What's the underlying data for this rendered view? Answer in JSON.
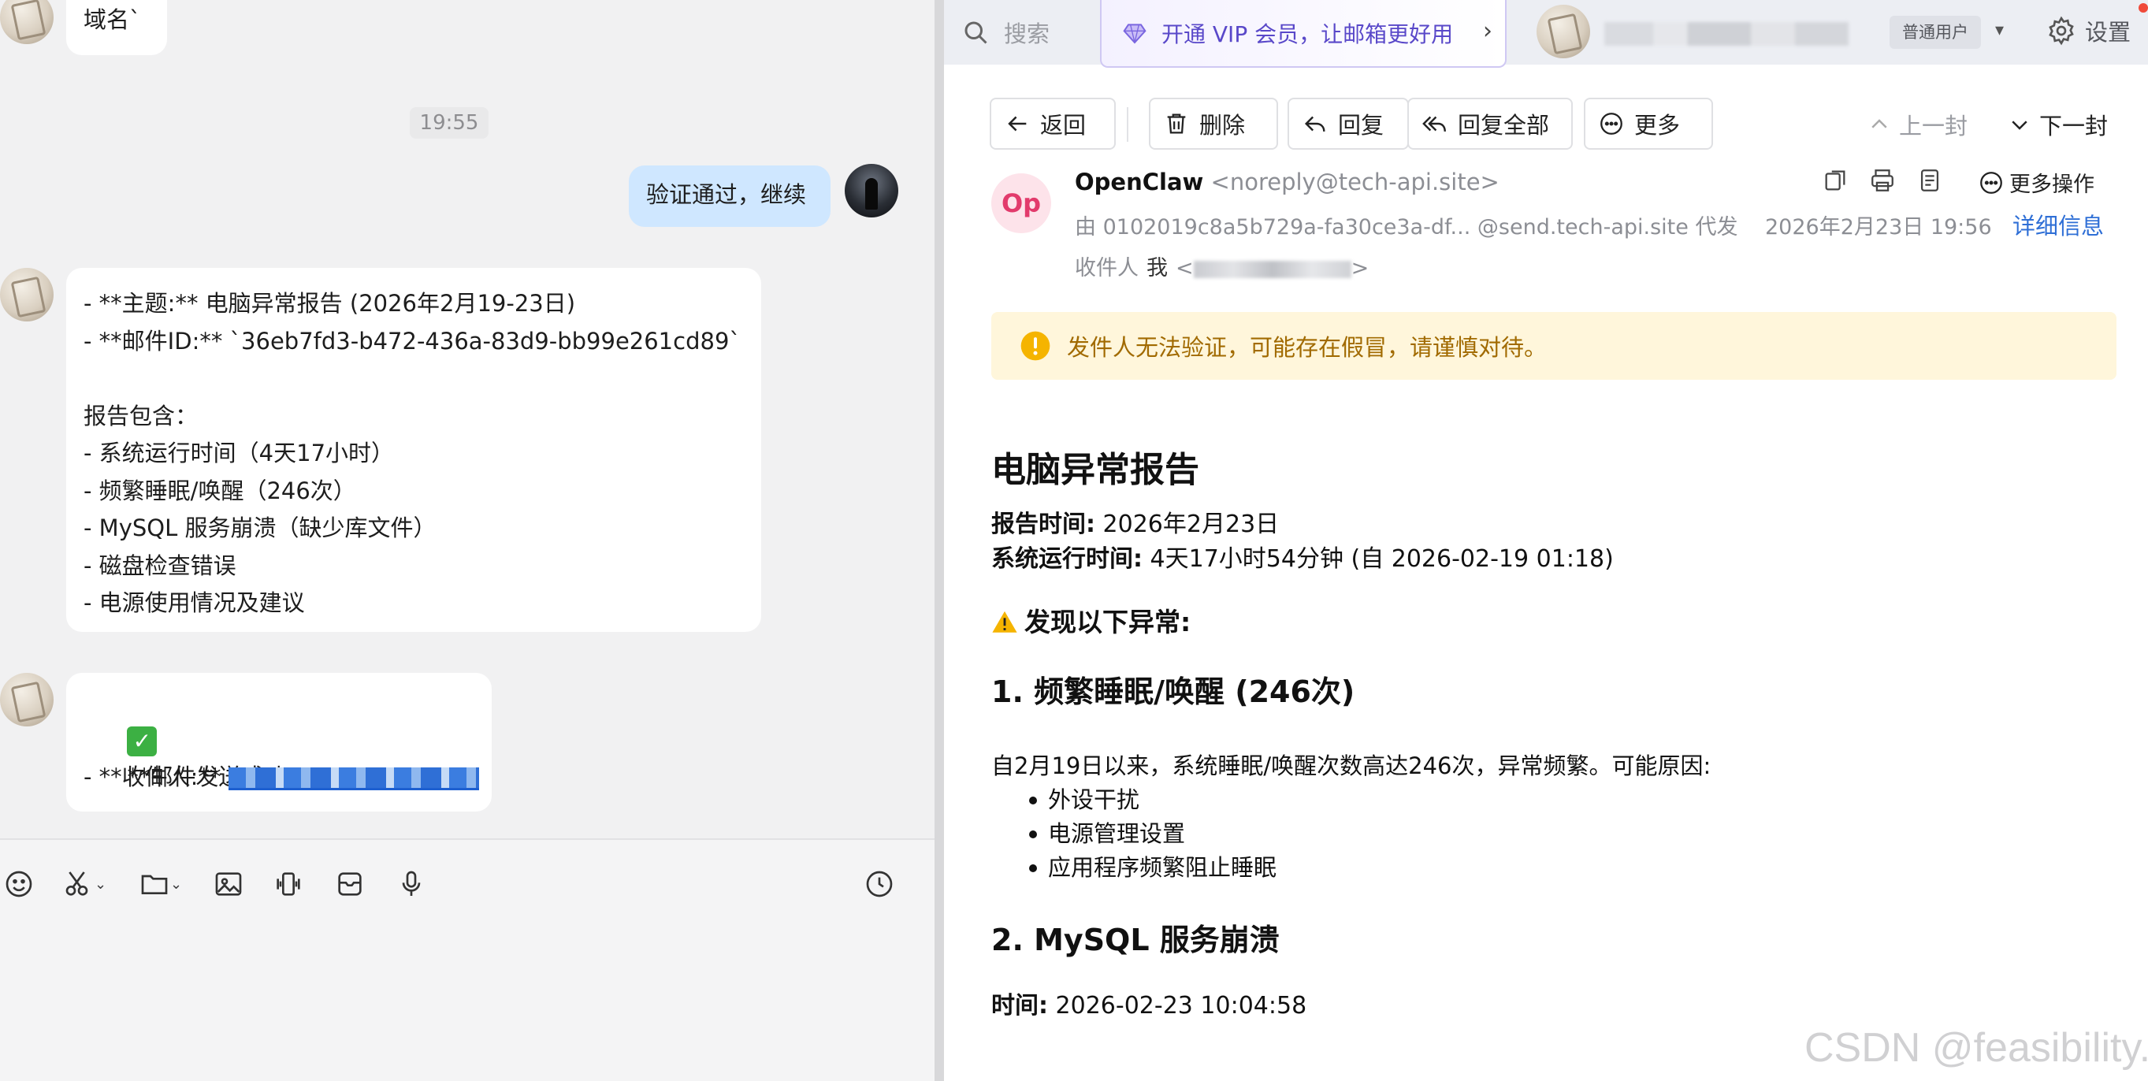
{
  "chat": {
    "partial_message": "域名`",
    "time_divider": "19:55",
    "user_message": "验证通过，继续",
    "summary_lines": [
      "- **主题:** 电脑异常报告 (2026年2月19-23日)",
      "- **邮件ID:** `36eb7fd3-b472-436a-83d9-bb99e261cd89`",
      "",
      "报告包含：",
      "- 系统运行时间（4天17小时）",
      "- 频繁睡眠/唤醒（246次）",
      "- MySQL 服务崩溃（缺少库文件）",
      "- 磁盘检查错误",
      "- 电源使用情况及建议"
    ],
    "success_line": "**邮件发送成功！**",
    "recipient_prefix": "- **收件人:** ",
    "toolbar": [
      "emoji-icon",
      "scissors-icon",
      "folder-icon",
      "image-icon",
      "shake-icon",
      "inbox-icon",
      "microphone-icon",
      "clock-icon"
    ]
  },
  "mail": {
    "search_placeholder": "搜索",
    "vip_banner": "开通 VIP 会员，让邮箱更好用",
    "user_badge": "普通用户",
    "settings_label": "设置",
    "actions": {
      "back": "返回",
      "delete": "删除",
      "reply": "回复",
      "reply_all": "回复全部",
      "more": "更多",
      "prev": "上一封",
      "next": "下一封"
    },
    "header": {
      "avatar_text": "Op",
      "sender_name": "OpenClaw",
      "sender_email": "<noreply@tech-api.site>",
      "more_ops": "更多操作",
      "via_prefix": "由",
      "via_address": "0102019c8a5b729a-fa30ce3a-df...",
      "via_domain": "@send.tech-api.site",
      "via_suffix": "代发",
      "date": "2026年2月23日 19:56",
      "details_link": "详细信息",
      "recipient_label": "收件人",
      "recipient_me": "我",
      "recipient_open": "<",
      "recipient_close": ">"
    },
    "warning": "发件人无法验证，可能存在假冒，请谨慎对待。",
    "body": {
      "title": "电脑异常报告",
      "report_time_label": "报告时间:",
      "report_time_value": "2026年2月23日",
      "uptime_label": "系统运行时间:",
      "uptime_value": "4天17小时54分钟 (自 2026-02-19 01:18)",
      "anomalies_heading": "发现以下异常:",
      "section1_title": "1. 频繁睡眠/唤醒 (246次)",
      "section1_text": "自2月19日以来，系统睡眠/唤醒次数高达246次，异常频繁。可能原因:",
      "section1_items": [
        "外设干扰",
        "电源管理设置",
        "应用程序频繁阻止睡眠"
      ],
      "section2_title": "2. MySQL 服务崩溃",
      "section2_time_label": "时间:",
      "section2_time_value": "2026-02-23 10:04:58"
    },
    "watermark": "CSDN @feasibility."
  },
  "colors": {
    "accent_blue": "#2f6fd6",
    "bubble_me": "#cfe7ff",
    "warning_bg": "#fff6db",
    "warning_text": "#a16a00",
    "vip_purple": "#5948c9"
  }
}
